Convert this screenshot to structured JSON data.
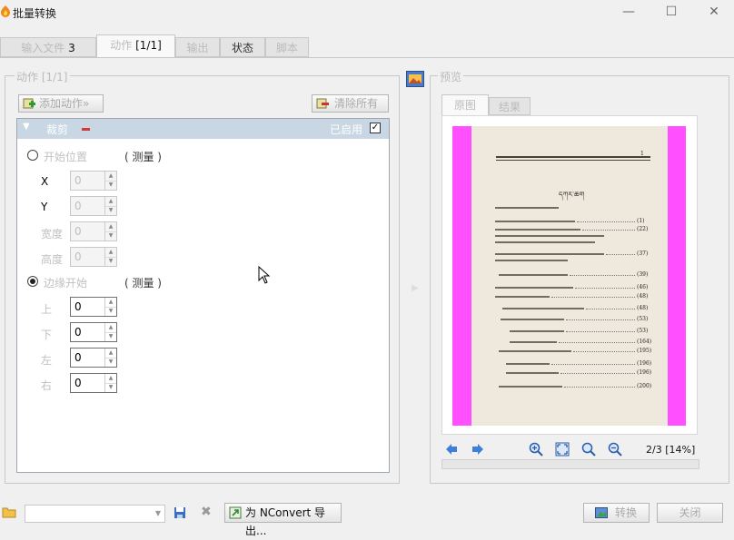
{
  "window": {
    "title": "批量转换",
    "minimize_glyph": "—",
    "maximize_glyph": "☐",
    "close_glyph": "✕"
  },
  "tabs": [
    {
      "label": "输入文件",
      "count": "3"
    },
    {
      "label": "动作",
      "count": "[1/1]"
    },
    {
      "label": "输出"
    },
    {
      "label": "状态"
    },
    {
      "label": "脚本"
    }
  ],
  "actions": {
    "legend": "动作 [1/1]",
    "add_button": "添加动作»",
    "clear_button": "清除所有",
    "crop": {
      "title": "裁剪",
      "enabled_label": "已启用",
      "enabled": true,
      "start_position": {
        "label": "开始位置",
        "link_text": "( 测量 )",
        "x_label": "X",
        "x": "0",
        "y_label": "Y",
        "y": "0",
        "width_label": "宽度",
        "width": "0",
        "height_label": "高度",
        "height": "0"
      },
      "margins": {
        "label": "边缘开始",
        "link_text": "( 测量 )",
        "top_label": "上",
        "top": "0",
        "bottom_label": "下",
        "bottom": "0",
        "left_label": "左",
        "left": "0",
        "right_label": "右",
        "right": "0"
      }
    }
  },
  "preview": {
    "legend": "预览",
    "tab_original": "原图",
    "tab_result": "结果",
    "page_counter": "2/3 [14%]",
    "canvas_color": "#ff4fff",
    "page": {
      "heading": "དཀར་ཆག",
      "toc_numbers": [
        "(1)",
        "(22)",
        "(37)",
        "(39)",
        "(46)",
        "(48)",
        "(48)",
        "(53)",
        "(53)",
        "(164)",
        "(195)",
        "(196)",
        "(196)",
        "(200)"
      ]
    }
  },
  "footer": {
    "combo_value": "",
    "export_button": "为 NConvert 导出...",
    "convert_button": "转换",
    "close_button": "关闭"
  },
  "colors": {
    "accent_header": "#c9d6e3",
    "window_bg": "#f0f0f0"
  }
}
